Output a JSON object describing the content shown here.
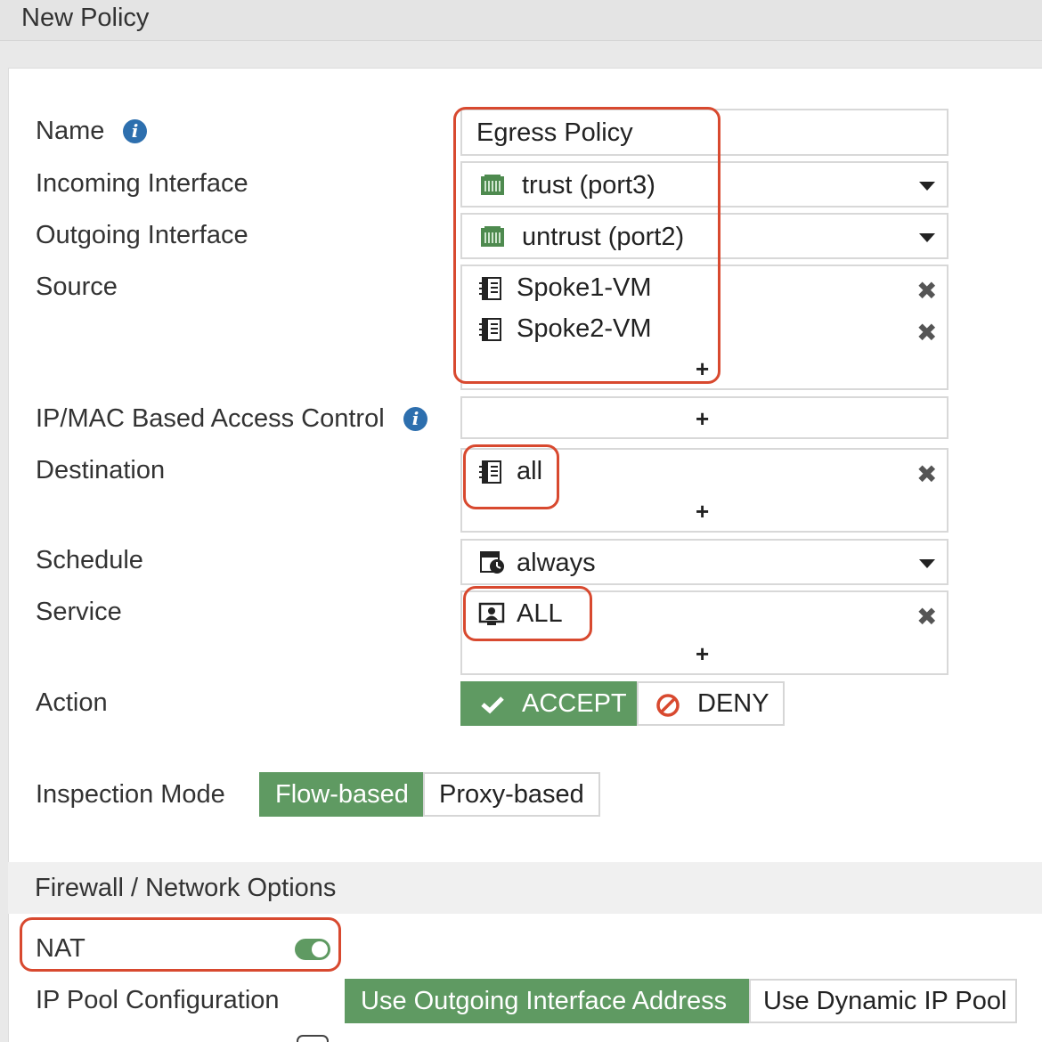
{
  "window": {
    "title": "New Policy"
  },
  "form": {
    "name": {
      "label": "Name",
      "value": "Egress Policy"
    },
    "incoming": {
      "label": "Incoming Interface",
      "value": "trust (port3)"
    },
    "outgoing": {
      "label": "Outgoing Interface",
      "value": "untrust (port2)"
    },
    "source": {
      "label": "Source",
      "items": [
        "Spoke1-VM",
        "Spoke2-VM"
      ]
    },
    "ipmac": {
      "label": "IP/MAC Based Access Control"
    },
    "destination": {
      "label": "Destination",
      "items": [
        "all"
      ]
    },
    "schedule": {
      "label": "Schedule",
      "value": "always"
    },
    "service": {
      "label": "Service",
      "items": [
        "ALL"
      ]
    },
    "action": {
      "label": "Action",
      "options": [
        "ACCEPT",
        "DENY"
      ],
      "selected": "ACCEPT"
    },
    "inspection": {
      "label": "Inspection Mode",
      "options": [
        "Flow-based",
        "Proxy-based"
      ],
      "selected": "Flow-based"
    }
  },
  "firewall_section": {
    "title": "Firewall / Network Options",
    "nat": {
      "label": "NAT",
      "enabled": true
    },
    "ip_pool": {
      "label": "IP Pool Configuration",
      "options": [
        "Use Outgoing Interface Address",
        "Use Dynamic IP Pool"
      ],
      "selected": "Use Outgoing Interface Address"
    }
  },
  "icons": {
    "info": "info-icon",
    "interface": "network-port-icon",
    "address": "address-book-icon",
    "schedule": "schedule-clock-icon",
    "service": "service-icon",
    "remove": "remove-x-icon",
    "add": "plus-icon",
    "accept": "checkmark-icon",
    "deny": "deny-circle-icon"
  },
  "colors": {
    "accent_green": "#5f9a62",
    "highlight_red": "#d8492f",
    "info_blue": "#2d6fae"
  }
}
